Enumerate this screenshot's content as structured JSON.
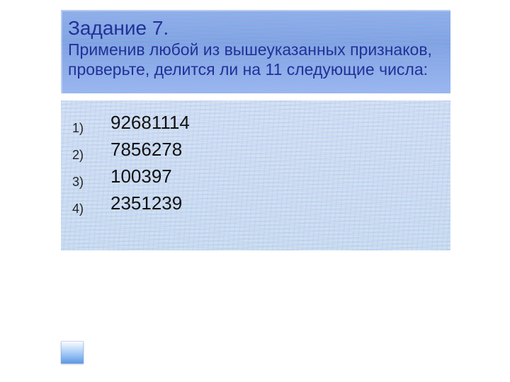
{
  "header": {
    "title_strong": "Задание 7.",
    "line1": "Применив любой из вышеуказанных признаков,",
    "line2": "проверьте, делится ли на 11 следующие числа:"
  },
  "items": [
    "92681114",
    "7856278",
    "100397",
    "2351239"
  ]
}
